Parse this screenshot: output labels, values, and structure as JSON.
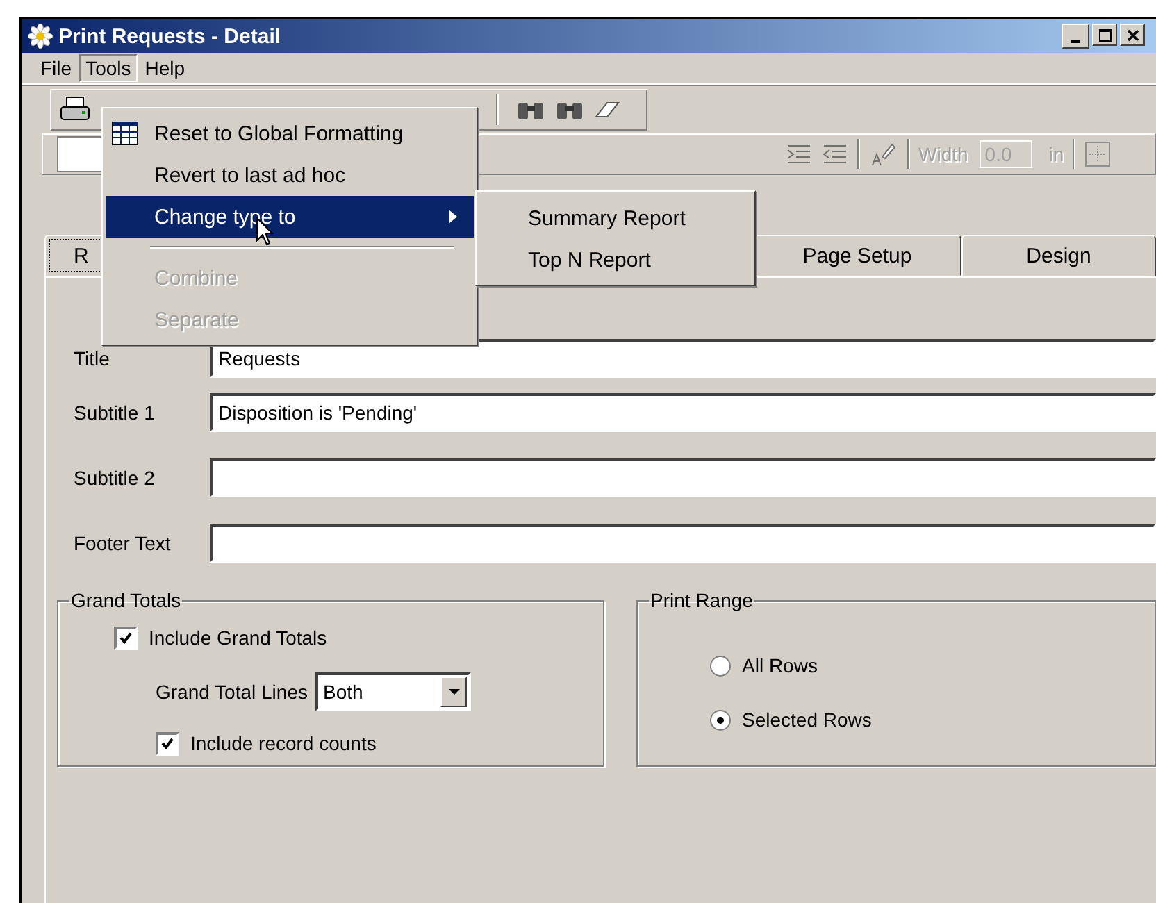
{
  "window": {
    "title": "Print Requests - Detail"
  },
  "menu_bar": [
    {
      "label": "File",
      "selected": false
    },
    {
      "label": "Tools",
      "selected": true
    },
    {
      "label": "Help",
      "selected": false
    }
  ],
  "format_bar": {
    "width_label": "Width",
    "width_value": "0.0",
    "unit": "in"
  },
  "tabs": [
    {
      "label": "R",
      "selected": true
    },
    {
      "label": "Page Setup",
      "selected": false
    },
    {
      "label": "Design",
      "selected": false
    }
  ],
  "fields": [
    {
      "label": "Title",
      "value": "Requests"
    },
    {
      "label": "Subtitle 1",
      "value": "Disposition is 'Pending'"
    },
    {
      "label": "Subtitle 2"
    },
    {
      "label": "Footer Text"
    }
  ],
  "grand_totals": {
    "title": "Grand Totals",
    "include": {
      "label": "Include Grand Totals",
      "checked": true
    },
    "lines_label": "Grand Total Lines",
    "lines_value": "Both",
    "record_counts": {
      "label": "Include record counts",
      "checked": true
    }
  },
  "print_range": {
    "title": "Print Range",
    "options": [
      {
        "label": "All Rows",
        "selected": false
      },
      {
        "label": "Selected Rows",
        "selected": true
      }
    ]
  },
  "tools_menu": [
    {
      "kind": "icon-item",
      "label": "Reset to Global Formatting",
      "selected": false,
      "disabled": false
    },
    {
      "kind": "item",
      "label": "Revert to last ad hoc",
      "selected": false,
      "disabled": false
    },
    {
      "kind": "submenu",
      "label": "Change type to",
      "selected": true,
      "disabled": false
    },
    {
      "kind": "separator"
    },
    {
      "kind": "item",
      "label": "Combine",
      "selected": false,
      "disabled": true
    },
    {
      "kind": "item",
      "label": "Separate",
      "selected": false,
      "disabled": true
    }
  ],
  "type_submenu": [
    {
      "label": "Summary Report"
    },
    {
      "label": "Top N Report"
    }
  ]
}
